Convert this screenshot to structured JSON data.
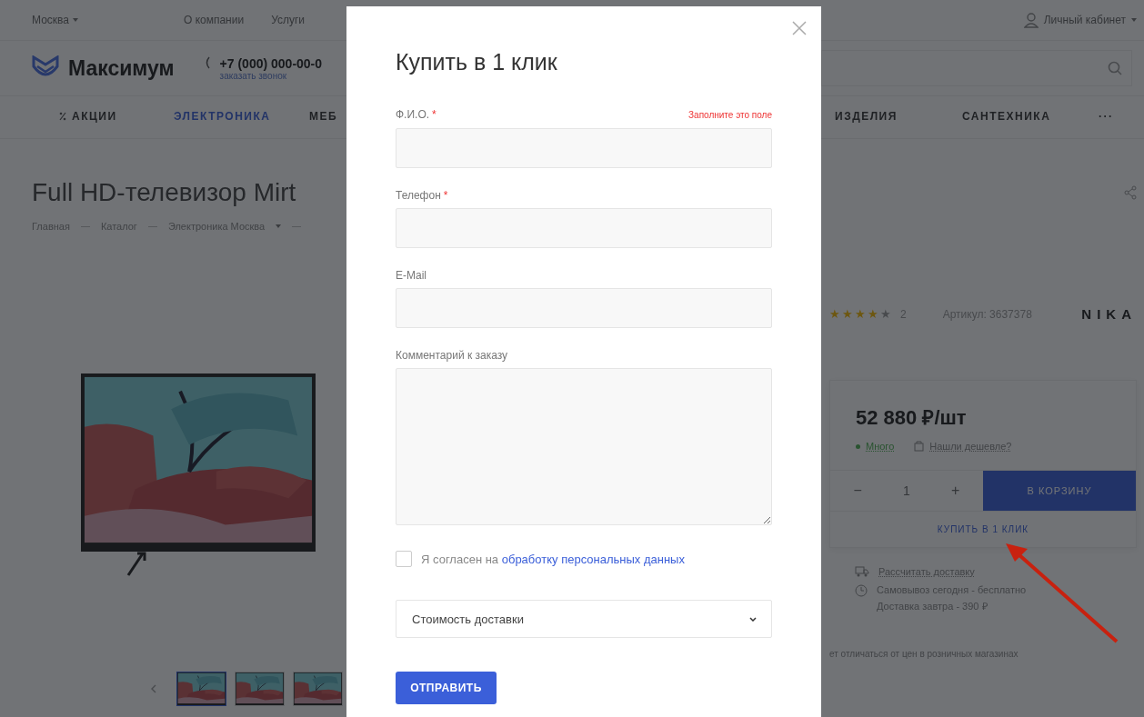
{
  "top_bar": {
    "city": "Москва",
    "links": [
      "О компании",
      "Услуги"
    ],
    "account": "Личный кабинет"
  },
  "header": {
    "logo": "Максимум",
    "phone": "+7 (000) 000-00-0",
    "callback": "заказать звонок"
  },
  "nav": [
    {
      "label": "АКЦИИ",
      "selected": false,
      "kind": "promo"
    },
    {
      "label": "ЭЛЕКТРОНИКА",
      "selected": true,
      "kind": "plain"
    },
    {
      "label": "МЕБ",
      "selected": false,
      "kind": "plain"
    },
    {
      "label": "ИЗДЕЛИЯ",
      "selected": false,
      "kind": "plain"
    },
    {
      "label": "САНТЕХНИКА",
      "selected": false,
      "kind": "plain"
    },
    {
      "label": "···",
      "selected": false,
      "kind": "more"
    }
  ],
  "product": {
    "title": "Full HD-телевизор Mirt",
    "breadcrumbs": [
      "Главная",
      "Каталог",
      "Электроника Москва"
    ],
    "stars": 4,
    "reviews": "2",
    "article": "Артикул: 3637378",
    "brand": "NIKA",
    "price": "52 880 ₽/шт",
    "stock": "Много",
    "cheaper": "Нашли дешевле?",
    "minus": "−",
    "quantity": "1",
    "plus": "+",
    "cart_button": "В КОРЗИНУ",
    "one_click": "КУПИТЬ В 1 КЛИК",
    "delivery_link": "Рассчитать доставку",
    "pickup": [
      "Самовывоз сегодня - бесплатно",
      "Доставка завтра - 390 ₽"
    ],
    "note": "ет отличаться от цен в розничных магазинах",
    "thumbnails": [
      {
        "selected": true
      },
      {
        "selected": false
      },
      {
        "selected": false
      }
    ]
  },
  "modal": {
    "title": "Купить в 1 клик",
    "fields": [
      {
        "label": "Ф.И.О.",
        "required_mark": "*",
        "error": "Заполните это поле",
        "kind": "input"
      },
      {
        "label": "Телефон",
        "required_mark": "*",
        "kind": "input"
      },
      {
        "label": "E-Mail",
        "kind": "input"
      },
      {
        "label": "Комментарий к заказу",
        "kind": "textarea"
      }
    ],
    "consent": {
      "text": "Я согласен на",
      "link": "обработку персональных данных",
      "checked": false
    },
    "select": {
      "value": "Стоимость доставки",
      "expanded": false
    },
    "submit": "ОТПРАВИТЬ"
  }
}
